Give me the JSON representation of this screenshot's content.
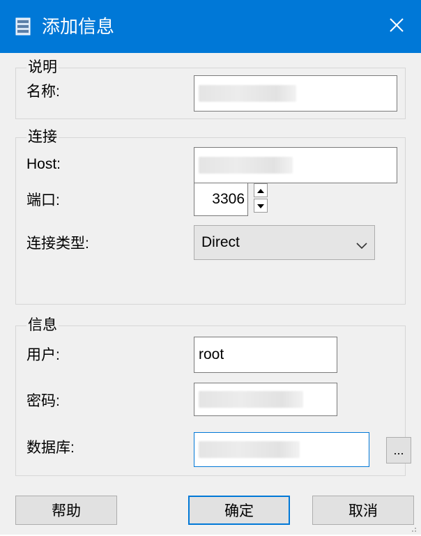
{
  "window": {
    "title": "添加信息",
    "title_icon": "database-icon",
    "close_icon": "close-icon",
    "accent_color": "#0078d7"
  },
  "description_group": {
    "title": "说明",
    "name_label": "名称:"
  },
  "connection_group": {
    "title": "连接",
    "host_label": "Host:",
    "port_label": "端口:",
    "port_value": "3306",
    "conn_type_label": "连接类型:",
    "conn_type_value": "Direct"
  },
  "info_group": {
    "title": "信息",
    "user_label": "用户:",
    "user_value": "root",
    "password_label": "密码:",
    "database_label": "数据库:",
    "browse_label": "..."
  },
  "buttons": {
    "help": "帮助",
    "ok": "确定",
    "cancel": "取消"
  }
}
